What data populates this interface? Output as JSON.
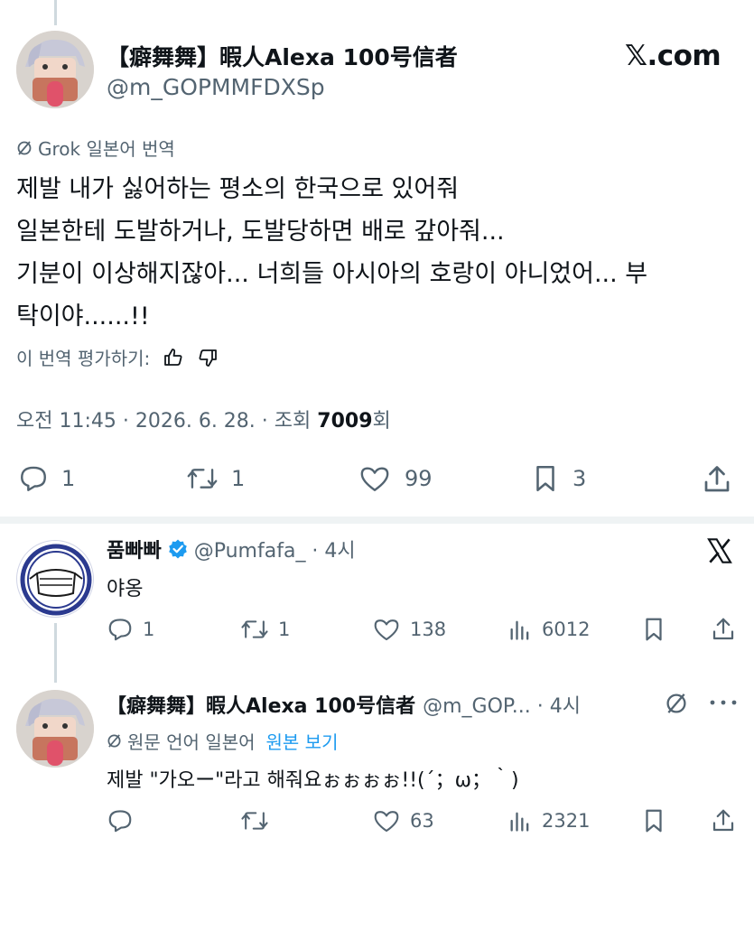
{
  "main_tweet": {
    "display_name": "【癖舞舞】暇人Alexa 100号信者",
    "handle": "@m_GOPMMFDXSp",
    "site_badge": "𝕏.com",
    "grok_label": "Grok 일본어 번역",
    "body_lines": [
      "제발 내가 싫어하는 평소의 한국으로 있어줘",
      "일본한테 도발하거나, 도발당하면 배로 갚아줘...",
      "기분이 이상해지잖아... 너희들 아시아의 호랑이 아니었어... 부",
      "탁이야......!!"
    ],
    "rate_label": "이 번역 평가하기:",
    "time": "오전 11:45 · 2026. 6. 28. · 조회 ",
    "views": "7009",
    "views_suffix": "회",
    "stats": {
      "replies": "1",
      "retweets": "1",
      "likes": "99",
      "bookmarks": "3"
    }
  },
  "reply_1": {
    "display_name": "품빠빠",
    "handle_time": "@Pumfafa_ · 4시",
    "text": "야옹",
    "stats": {
      "replies": "1",
      "retweets": "1",
      "likes": "138",
      "views": "6012"
    }
  },
  "reply_2": {
    "display_name": "【癖舞舞】暇人Alexa 100号信者",
    "handle_time": "@m_GOP... · 4시",
    "translation_label": "원문 언어 일본어",
    "show_original": "원본 보기",
    "text": "제발 \"가오ー\"라고 해줘요ぉぉぉぉ!!(´；ω；｀)",
    "stats": {
      "likes": "63",
      "views": "2321"
    }
  },
  "icons": [
    "grok-icon",
    "thumbs-up-icon",
    "thumbs-down-icon",
    "reply-icon",
    "retweet-icon",
    "like-icon",
    "bookmark-icon",
    "share-icon",
    "views-icon",
    "x-logo-icon",
    "verified-icon",
    "more-icon"
  ],
  "colors": {
    "text": "#0f1419",
    "muted": "#536471",
    "link": "#1d9bf0",
    "verified": "#1d9bf0",
    "divider": "#eff3f4"
  }
}
